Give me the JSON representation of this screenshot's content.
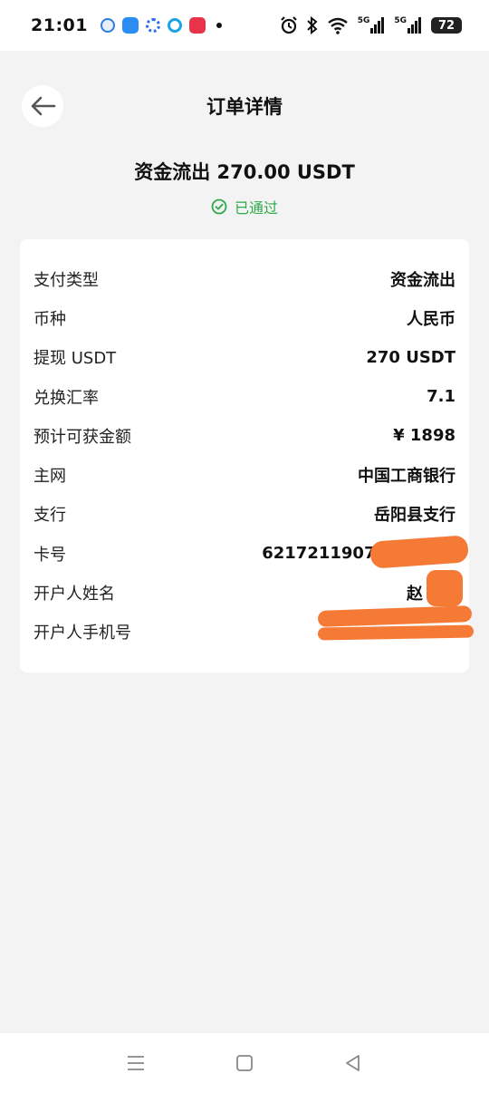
{
  "status_bar": {
    "time": "21:01",
    "signal_1": "5G",
    "signal_2": "5G",
    "battery": "72"
  },
  "header": {
    "title": "订单详情"
  },
  "summary": {
    "amount": "资金流出 270.00 USDT",
    "status": "已通过",
    "status_color": "#2eaa4a"
  },
  "details": [
    {
      "label": "支付类型",
      "value": "资金流出"
    },
    {
      "label": "币种",
      "value": "人民币"
    },
    {
      "label": "提现 USDT",
      "value": "270 USDT"
    },
    {
      "label": "兑换汇率",
      "value": "7.1"
    },
    {
      "label": "预计可获金额",
      "value": "¥ 1898"
    },
    {
      "label": "主网",
      "value": "中国工商银行"
    },
    {
      "label": "支行",
      "value": "岳阳县支行"
    },
    {
      "label": "卡号",
      "value": "62172119070"
    },
    {
      "label": "开户人姓名",
      "value": "赵"
    },
    {
      "label": "开户人手机号",
      "value": ""
    }
  ],
  "redaction_color": "#f47a36"
}
